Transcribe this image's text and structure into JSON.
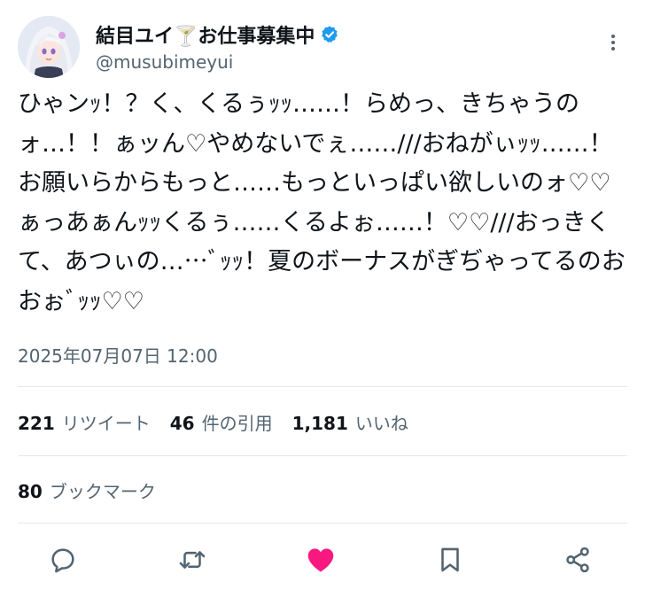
{
  "author": {
    "display_name": "結目ユイ🍸お仕事募集中",
    "handle": "@musubimeyui",
    "verified": true
  },
  "tweet": {
    "text": "ひゃンｯ！？く、くるぅｯｯ……！らめっ、きちゃうのォ…！！ぁッん♡やめないでぇ……///おねがぃｯｯ……！お願いらからもっと……もっといっぱい欲しいのォ♡♡ぁっあぁんｯｯくるぅ……くるよぉ……！♡♡///おっきくて、あつぃの……ﾞｯｯ！夏のボーナスがぎぢゃってるのおおぉﾞｯｯ♡♡",
    "timestamp": "2025年07月07日 12:00"
  },
  "stats": {
    "retweets_count": "221",
    "retweets_label": "リツイート",
    "quotes_count": "46",
    "quotes_label": "件の引用",
    "likes_count": "1,181",
    "likes_label": "いいね",
    "bookmarks_count": "80",
    "bookmarks_label": "ブックマーク"
  },
  "actions": [
    {
      "icon": "reply-icon"
    },
    {
      "icon": "retweet-icon"
    },
    {
      "icon": "like-icon",
      "active": true
    },
    {
      "icon": "bookmark-icon"
    },
    {
      "icon": "share-icon"
    }
  ],
  "colors": {
    "text": "#0f1419",
    "secondary_text": "#536471",
    "verified_blue": "#1d9bf0",
    "like_pink": "#f91880",
    "divider": "#e3e8ec",
    "icon_gray": "#536471"
  }
}
